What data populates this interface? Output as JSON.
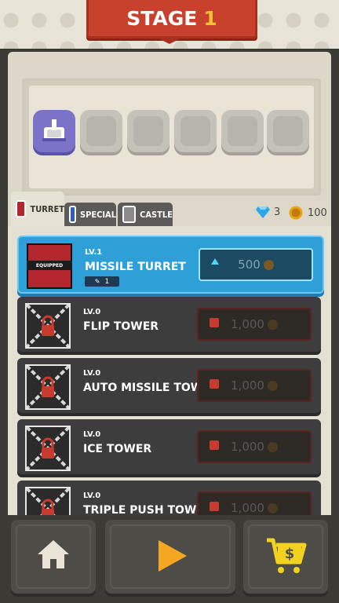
{
  "header": {
    "stage_word": "STAGE",
    "stage_number": "1"
  },
  "tabs": [
    {
      "label": "TURRET",
      "selected": true
    },
    {
      "label": "SPECIAL",
      "selected": false
    },
    {
      "label": "CASTLE",
      "selected": false
    }
  ],
  "resources": {
    "gems": "3",
    "coins": "100"
  },
  "slots": {
    "total": 6,
    "filled": 1
  },
  "towers": [
    {
      "level": "LV.1",
      "name": "MISSILE TURRET",
      "badge": "EQUIPPED",
      "count": "1",
      "cost": "500",
      "selected": true,
      "locked": false
    },
    {
      "level": "LV.0",
      "name": "FLIP TOWER",
      "cost": "1,000",
      "selected": false,
      "locked": true
    },
    {
      "level": "LV.0",
      "name": "AUTO MISSILE TOWER",
      "cost": "1,000",
      "selected": false,
      "locked": true
    },
    {
      "level": "LV.0",
      "name": "ICE TOWER",
      "cost": "1,000",
      "selected": false,
      "locked": true
    },
    {
      "level": "LV.0",
      "name": "TRIPLE PUSH TOWER",
      "cost": "1,000",
      "selected": false,
      "locked": true
    }
  ],
  "bottom_nav": [
    {
      "icon": "home-icon"
    },
    {
      "icon": "play-icon"
    },
    {
      "icon": "shop-cart-icon"
    }
  ],
  "colors": {
    "banner": "#c8412c",
    "selected_row": "#2f9fd8",
    "stage_number": "#f2c233",
    "play": "#f5a623",
    "cart": "#f2d21e"
  }
}
